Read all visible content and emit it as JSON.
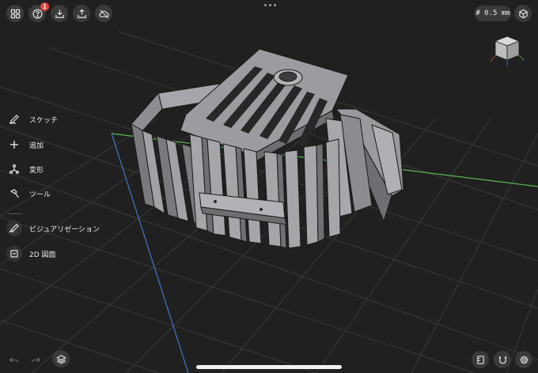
{
  "header": {
    "notification_count": "1",
    "grid_size": "# 0.5 mm"
  },
  "sidebar": {
    "items": [
      {
        "label": "スケッチ",
        "icon": "pencil-icon"
      },
      {
        "label": "追加",
        "icon": "plus-icon"
      },
      {
        "label": "変形",
        "icon": "transform-icon"
      },
      {
        "label": "ツール",
        "icon": "hammer-icon"
      },
      {
        "label": "ビジュアリゼーション",
        "icon": "visualization-icon"
      },
      {
        "label": "2D 図面",
        "icon": "drawing-2d-icon"
      }
    ]
  },
  "colors": {
    "background": "#202020",
    "grid": "#3c3c3c",
    "model_face": "#8d8d91",
    "model_face_light": "#a9a9ad",
    "model_edge": "#1a1a1a",
    "axis_x": "#c94a3f",
    "axis_y": "#57b84c",
    "axis_z": "#3f78c9",
    "button_bg": "#3a3a3a",
    "badge": "#e0443a"
  }
}
